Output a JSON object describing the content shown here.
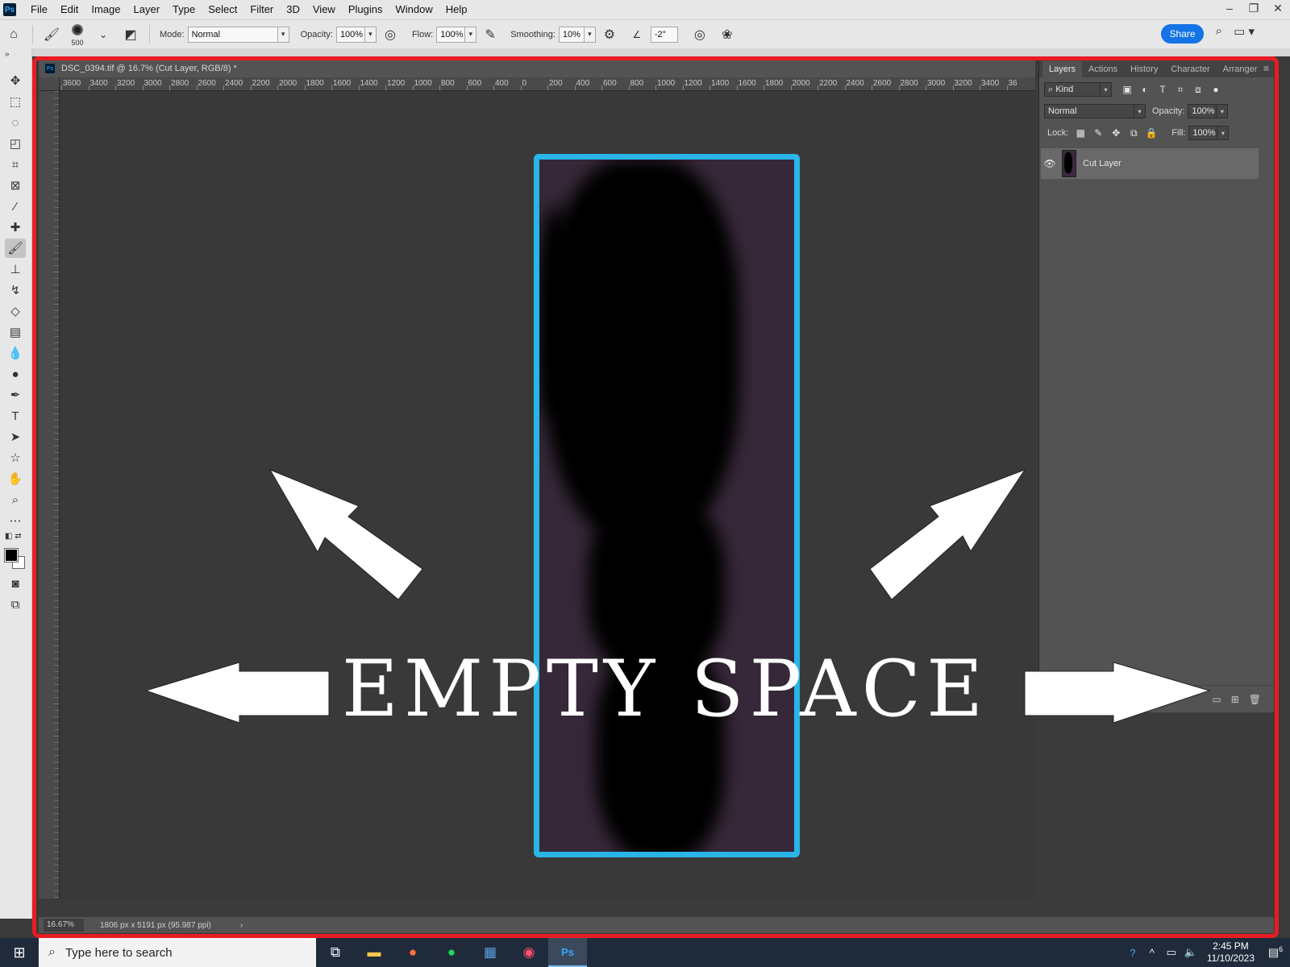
{
  "app": {
    "logo": "Ps",
    "menu": [
      "File",
      "Edit",
      "Image",
      "Layer",
      "Type",
      "Select",
      "Filter",
      "3D",
      "View",
      "Plugins",
      "Window",
      "Help"
    ],
    "window_controls": [
      "minimize-icon",
      "restore-icon",
      "close-icon"
    ]
  },
  "options": {
    "brush_size": "500",
    "mode_label": "Mode:",
    "mode_value": "Normal",
    "opacity_label": "Opacity:",
    "opacity_value": "100%",
    "flow_label": "Flow:",
    "flow_value": "100%",
    "smoothing_label": "Smoothing:",
    "smoothing_value": "10%",
    "angle_value": "-2°",
    "share_label": "Share"
  },
  "document": {
    "title": "DSC_0394.tif @ 16.7% (Cut Layer, RGB/8) *",
    "ruler_ticks": [
      "3600",
      "3400",
      "3200",
      "3000",
      "2800",
      "2600",
      "2400",
      "2200",
      "2000",
      "1800",
      "1600",
      "1400",
      "1200",
      "1000",
      "800",
      "600",
      "400",
      "0",
      "200",
      "400",
      "600",
      "800",
      "1000",
      "1200",
      "1400",
      "1600",
      "1800",
      "2000",
      "2200",
      "2400",
      "2600",
      "2800",
      "3000",
      "3200",
      "3400",
      "36"
    ],
    "zoom": "16.67%",
    "dimensions": "1806 px x 5191 px (95.987 ppi)",
    "status_chevron": "›"
  },
  "layers_panel": {
    "tabs": [
      "Layers",
      "Actions",
      "History",
      "Character",
      "Arranger"
    ],
    "filter_kind": "Kind",
    "blend_mode": "Normal",
    "opacity_label": "Opacity:",
    "opacity_value": "100%",
    "lock_label": "Lock:",
    "fill_label": "Fill:",
    "fill_value": "100%",
    "layers": [
      {
        "name": "Cut Layer"
      }
    ]
  },
  "annotation": {
    "text": "EMPTY SPACE",
    "border_color": "#e81c24",
    "frame_color": "#29b5e8"
  },
  "taskbar": {
    "search_placeholder": "Type here to search",
    "time": "2:45 PM",
    "date": "11/10/2023",
    "notification_count": "6"
  }
}
